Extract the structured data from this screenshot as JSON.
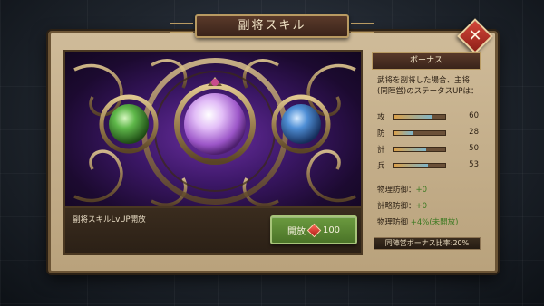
{
  "title": "副将スキル",
  "skill_description": "副将スキルLvUP開放",
  "open_button": {
    "label": "開放",
    "cost": "100"
  },
  "gems": [
    {
      "name": "green-gem",
      "color": "#5fb84a"
    },
    {
      "name": "purple-gem",
      "color": "#c28be6"
    },
    {
      "name": "blue-gem",
      "color": "#4f8fd6"
    }
  ],
  "bonus": {
    "header": "ボーナス",
    "description": "武将を副将した場合、主将(同陣営)のステータスUPは：",
    "stats": [
      {
        "label": "攻",
        "value": "60",
        "level": 0.75
      },
      {
        "label": "防",
        "value": "28",
        "level": 0.35
      },
      {
        "label": "計",
        "value": "50",
        "level": 0.62
      },
      {
        "label": "兵",
        "value": "53",
        "level": 0.66
      }
    ],
    "defenses": [
      {
        "label": "物理防御：",
        "value": "+0"
      },
      {
        "label": "計略防御：",
        "value": "+0"
      },
      {
        "label": "物理防御",
        "value": "+4%(未開放)"
      }
    ],
    "ratio_label": "同陣営ボーナス比率:20%"
  }
}
